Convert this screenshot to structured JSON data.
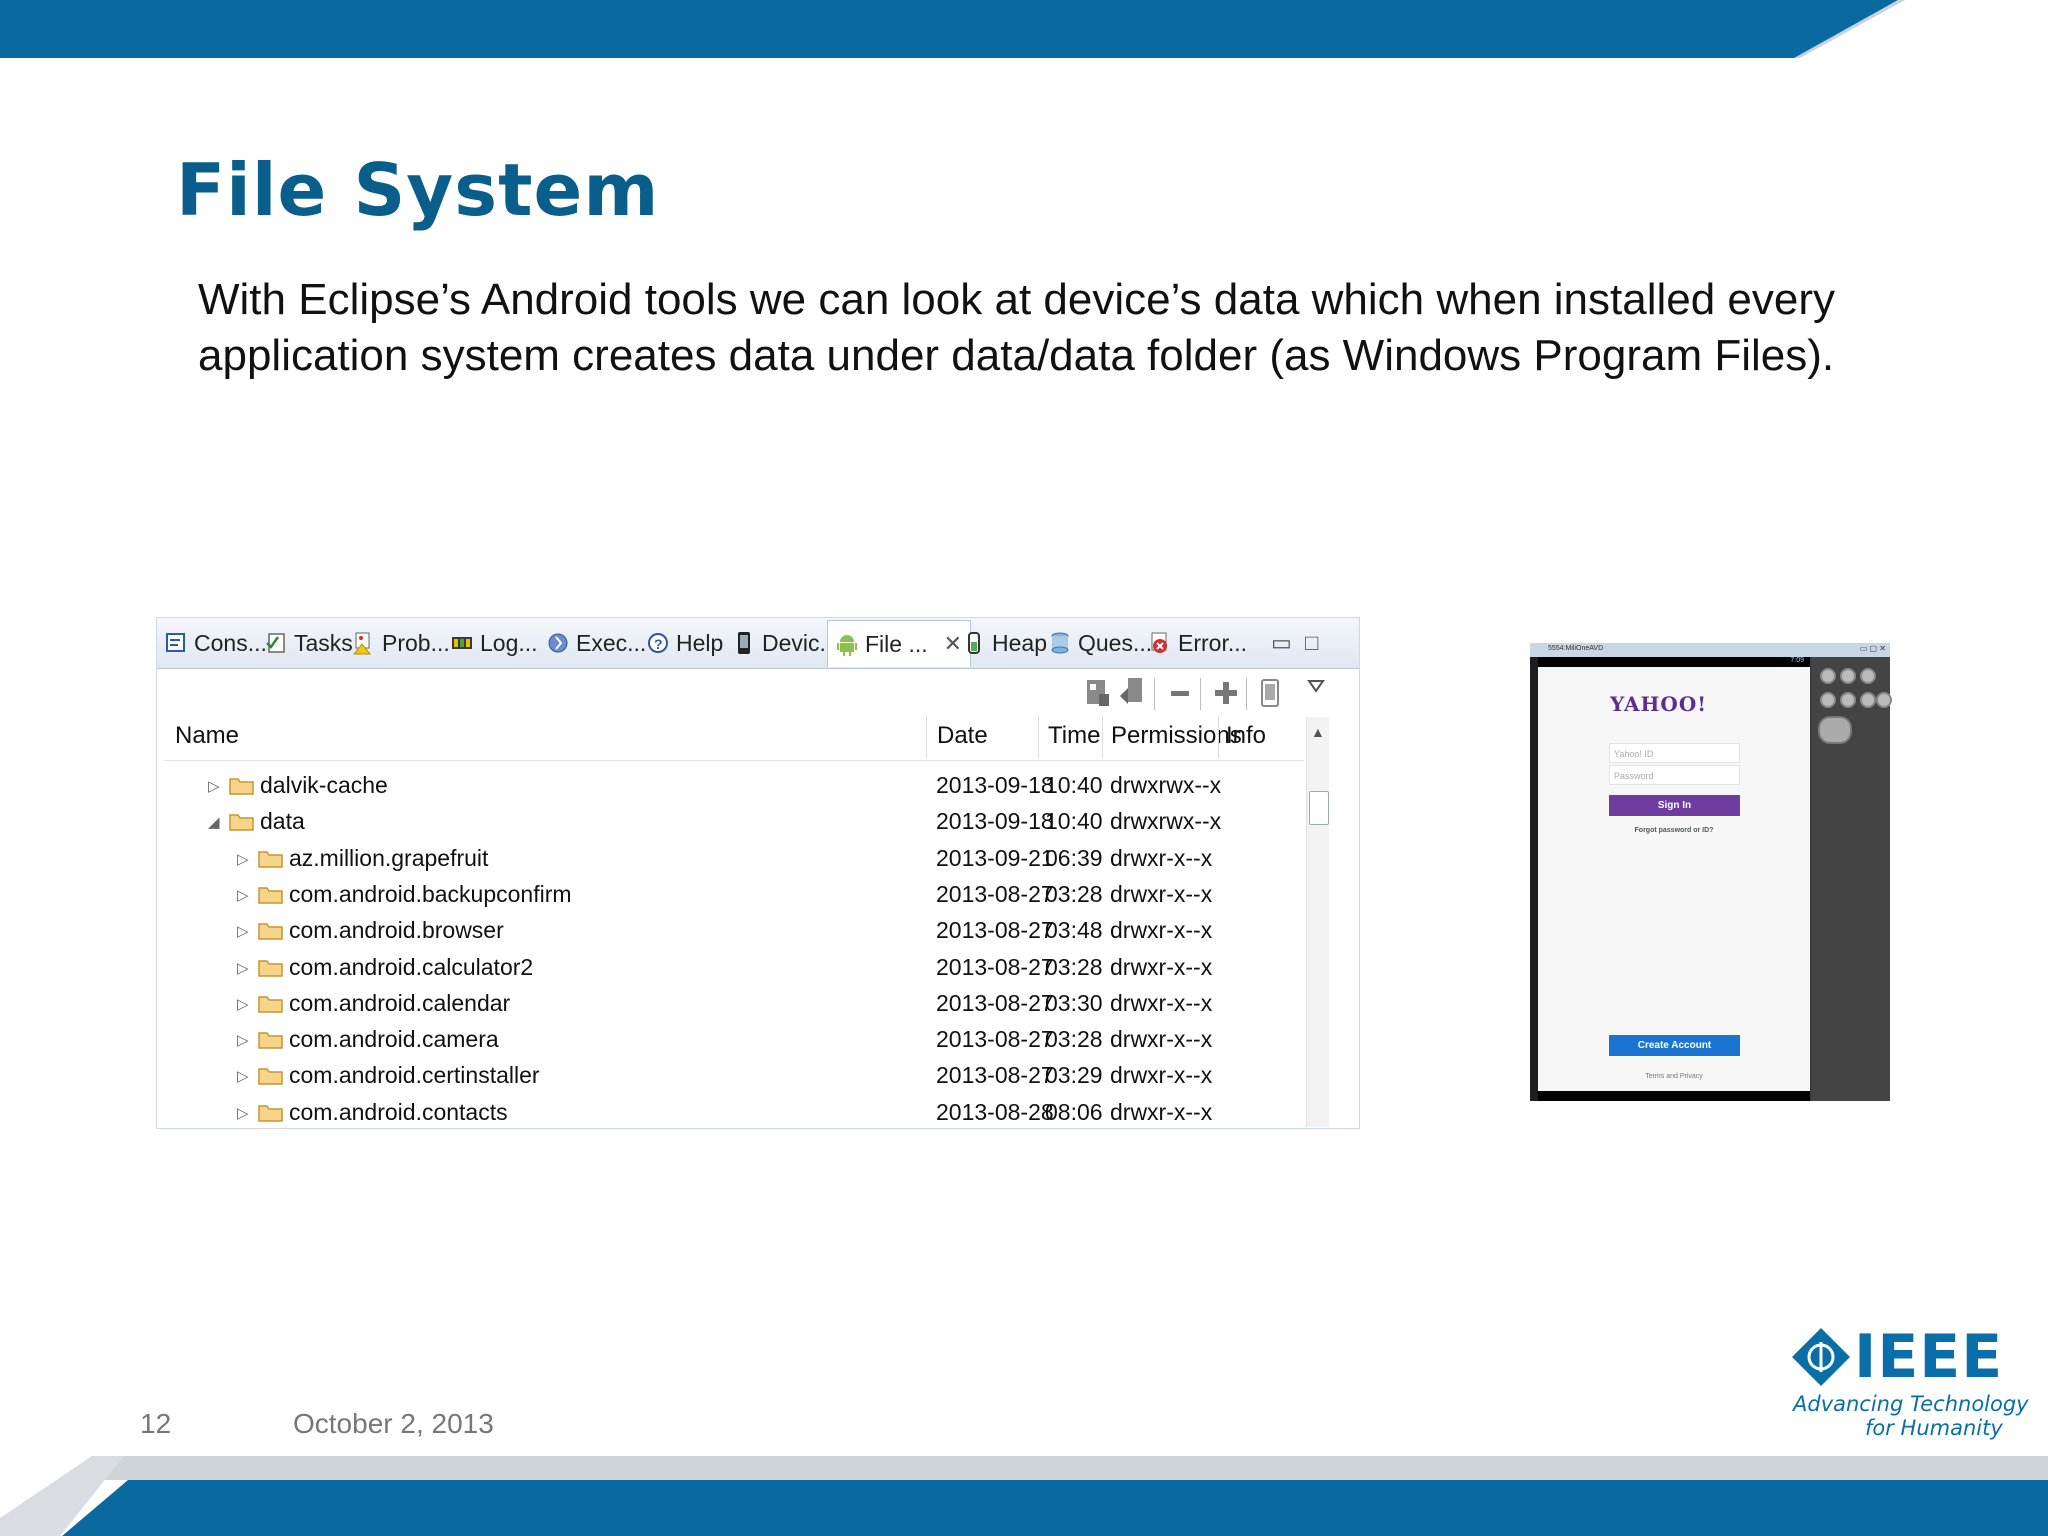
{
  "slide": {
    "title": "File System",
    "body": "With Eclipse’s Android tools we can look at device’s data which when installed every application system creates data under data/data folder (as Windows Program Files).",
    "page_number": "12",
    "date": "October 2, 2013"
  },
  "colors": {
    "brand_blue": "#0a6fa8",
    "title_blue": "#0a5e8c",
    "yahoo_purple": "#6f3ca0",
    "create_blue": "#1b75d0"
  },
  "eclipse": {
    "tabs": [
      {
        "label": "Cons...",
        "icon": "console-icon"
      },
      {
        "label": "Tasks",
        "icon": "tasks-icon"
      },
      {
        "label": "Prob...",
        "icon": "problems-icon"
      },
      {
        "label": "Log...",
        "icon": "logcat-icon"
      },
      {
        "label": "Exec...",
        "icon": "executables-icon"
      },
      {
        "label": "Help",
        "icon": "help-icon"
      },
      {
        "label": "Devic...",
        "icon": "device-icon"
      },
      {
        "label": "File ...",
        "icon": "android-icon"
      },
      {
        "label": "Heap",
        "icon": "heap-icon"
      },
      {
        "label": "Ques...",
        "icon": "database-icon"
      },
      {
        "label": "Error...",
        "icon": "error-icon"
      }
    ],
    "columns": {
      "name": "Name",
      "date": "Date",
      "time": "Time",
      "permissions": "Permissions",
      "info": "Info"
    },
    "rows": [
      {
        "name": "dalvik-cache",
        "date": "2013-09-18",
        "time": "10:40",
        "perm": "drwxrwx--x",
        "expanded": false
      },
      {
        "name": "data",
        "date": "2013-09-18",
        "time": "10:40",
        "perm": "drwxrwx--x",
        "expanded": true
      },
      {
        "name": "az.million.grapefruit",
        "date": "2013-09-21",
        "time": "06:39",
        "perm": "drwxr-x--x",
        "expanded": false
      },
      {
        "name": "com.android.backupconfirm",
        "date": "2013-08-27",
        "time": "03:28",
        "perm": "drwxr-x--x",
        "expanded": false
      },
      {
        "name": "com.android.browser",
        "date": "2013-08-27",
        "time": "03:48",
        "perm": "drwxr-x--x",
        "expanded": false
      },
      {
        "name": "com.android.calculator2",
        "date": "2013-08-27",
        "time": "03:28",
        "perm": "drwxr-x--x",
        "expanded": false
      },
      {
        "name": "com.android.calendar",
        "date": "2013-08-27",
        "time": "03:30",
        "perm": "drwxr-x--x",
        "expanded": false
      },
      {
        "name": "com.android.camera",
        "date": "2013-08-27",
        "time": "03:28",
        "perm": "drwxr-x--x",
        "expanded": false
      },
      {
        "name": "com.android.certinstaller",
        "date": "2013-08-27",
        "time": "03:29",
        "perm": "drwxr-x--x",
        "expanded": false
      },
      {
        "name": "com.android.contacts",
        "date": "2013-08-28",
        "time": "08:06",
        "perm": "drwxr-x--x",
        "expanded": false
      }
    ]
  },
  "emulator": {
    "window_title": "5554:MiliOneAVD",
    "status_time": "7:09",
    "logo": "YAHOO!",
    "id_placeholder": "Yahoo! ID",
    "password_placeholder": "Password",
    "sign_in": "Sign In",
    "forgot": "Forgot password or ID?",
    "create_account": "Create Account",
    "terms": "Terms and Privacy"
  },
  "ieee": {
    "word": "IEEE",
    "tagline_1": "Advancing Technology",
    "tagline_2": "for Humanity"
  }
}
